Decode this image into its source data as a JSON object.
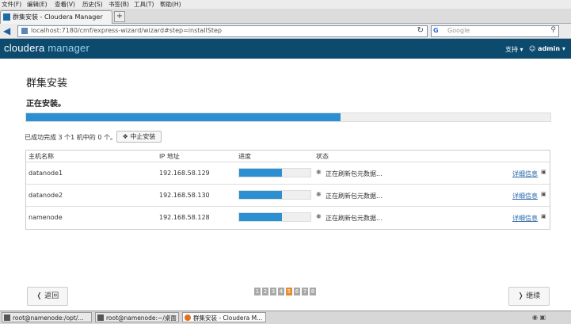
{
  "browser": {
    "menu": [
      "文件(F)",
      "编辑(E)",
      "查看(V)",
      "历史(S)",
      "书签(B)",
      "工具(T)",
      "帮助(H)"
    ],
    "tab_title": "群集安装 - Cloudera Manager",
    "tab_add": "+",
    "url": "localhost:7180/cmf/express-wizard/wizard#step=installStep",
    "search_placeholder": "Google",
    "search_engine_glyph": "G"
  },
  "app": {
    "logo_cloudera": "cloudera",
    "logo_manager": "manager",
    "support_menu": "支持",
    "user_menu": "admin"
  },
  "page": {
    "title": "群集安装",
    "subtitle": "正在安装。",
    "overall_progress": 0.6,
    "status_text": "已成功完成 3 个1 机中的 0 个。",
    "abort_button": "中止安装",
    "table_headers": {
      "host": "主机名称",
      "ip": "IP 地址",
      "progress": "进度",
      "status": "状态"
    },
    "hosts": [
      {
        "name": "datanode1",
        "ip": "192.168.58.129",
        "progress": 0.6,
        "status": "正在刷新包元数据...",
        "detail": "详细信息"
      },
      {
        "name": "datanode2",
        "ip": "192.168.58.130",
        "progress": 0.6,
        "status": "正在刷新包元数据...",
        "detail": "详细信息"
      },
      {
        "name": "namenode",
        "ip": "192.168.58.128",
        "progress": 0.6,
        "status": "正在刷新包元数据...",
        "detail": "详细信息"
      }
    ],
    "pager": [
      "1",
      "2",
      "3",
      "4",
      "5",
      "6",
      "7",
      "8"
    ],
    "pager_active": "5",
    "back_button": "返回",
    "next_button": "继续"
  },
  "taskbar": {
    "items": [
      "root@namenode:/opt/...",
      "root@namenode:~/桌面",
      "群集安装 - Cloudera M..."
    ]
  }
}
